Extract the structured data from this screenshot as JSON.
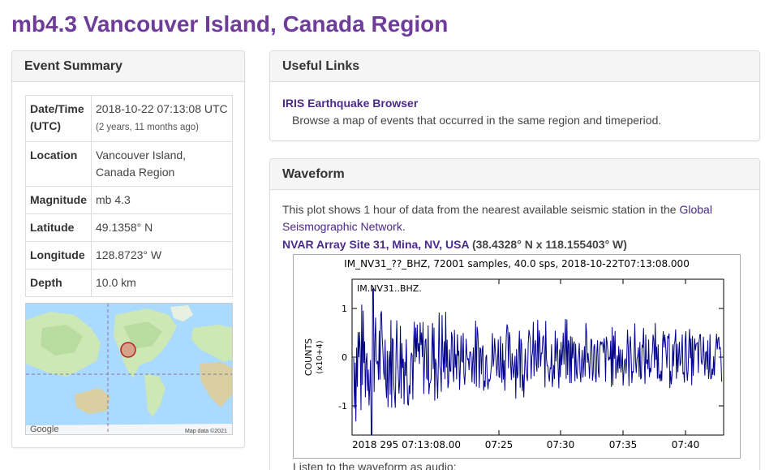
{
  "page": {
    "title": "mb4.3 Vancouver Island, Canada Region"
  },
  "summary": {
    "heading": "Event Summary",
    "rows": [
      {
        "key": "Date/Time (UTC)",
        "value": "2018-10-22 07:13:08 UTC",
        "note": "(2 years, 11 months ago)"
      },
      {
        "key": "Location",
        "value": "Vancouver Island, Canada Region"
      },
      {
        "key": "Magnitude",
        "value": "mb 4.3"
      },
      {
        "key": "Latitude",
        "value": "49.1358° N"
      },
      {
        "key": "Longitude",
        "value": "128.8723° W"
      },
      {
        "key": "Depth",
        "value": "10.0 km"
      }
    ],
    "map": {
      "logo": "Google",
      "credit": "Map data ©2021"
    }
  },
  "links": {
    "heading": "Useful Links",
    "item_label": "IRIS Earthquake Browser",
    "item_desc": "Browse a map of events that occurred in the same region and timeperiod."
  },
  "waveform": {
    "heading": "Waveform",
    "intro_text": "This plot shows 1 hour of data from the nearest available seismic station in the",
    "intro_link": "Global Seismographic Network",
    "intro_end": ".",
    "station_link": "NVAR Array Site 31, Mina, NV, USA",
    "station_coords": "(38.4328° N x 118.155403° W)",
    "plot": {
      "title": "IM_NV31_??_BHZ, 72001 samples, 40.0 sps, 2018-10-22T07:13:08.000",
      "trace_label": "IM.NV31..BHZ.",
      "ylabel": "COUNTS",
      "ylabel_scale": "(x10+4)",
      "yticks": [
        "1",
        "0",
        "-1"
      ],
      "xticks": [
        "2018 295 07:13:08.00",
        "07:25",
        "07:30",
        "07:35",
        "07:40"
      ]
    },
    "audio_label": "Listen to the waveform as audio:"
  },
  "colors": {
    "title": "#6f3c9a",
    "link": "#4a2a8a",
    "trace": "#00008b"
  }
}
